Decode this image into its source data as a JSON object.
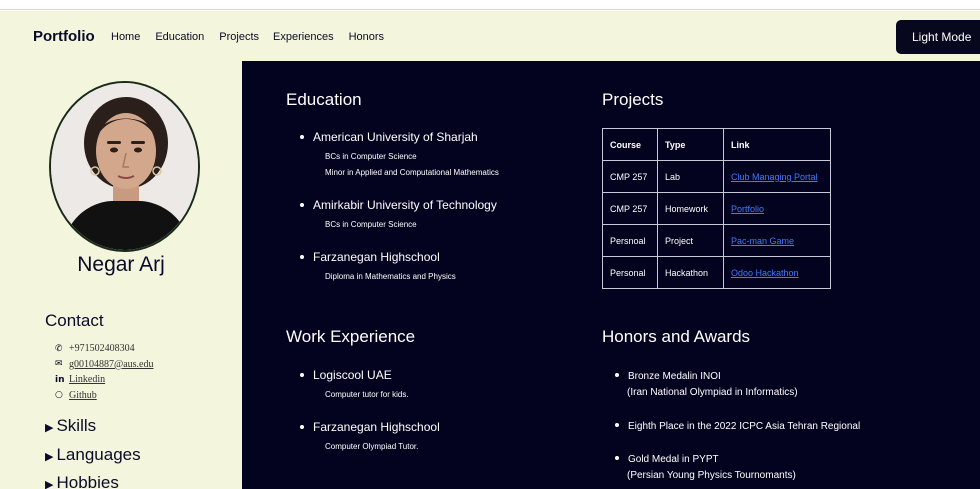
{
  "nav": {
    "brand": "Portfolio",
    "links": [
      "Home",
      "Education",
      "Projects",
      "Experiences",
      "Honors"
    ],
    "mode_button": "Light Mode"
  },
  "sidebar": {
    "name": "Negar Arj",
    "contact_title": "Contact",
    "contacts": [
      {
        "icon": "phone-icon",
        "text": "+971502408304"
      },
      {
        "icon": "email-icon",
        "text": "g00104887@aus.edu"
      },
      {
        "icon": "linkedin-icon",
        "text": "Linkedin"
      },
      {
        "icon": "github-icon",
        "text": "Github"
      }
    ],
    "sections": [
      "Skills",
      "Languages",
      "Hobbies"
    ]
  },
  "education": {
    "title": "Education",
    "items": [
      {
        "name": "American University of Sharjah",
        "details": [
          "BCs in Computer Science",
          "Minor in Applied and Computational Mathematics"
        ]
      },
      {
        "name": "Amirkabir University of Technology",
        "details": [
          "BCs in Computer Science"
        ]
      },
      {
        "name": "Farzanegan Highschool",
        "details": [
          "Diploma in Mathematics and Physics"
        ]
      }
    ]
  },
  "projects": {
    "title": "Projects",
    "headers": [
      "Course",
      "Type",
      "Link"
    ],
    "rows": [
      {
        "course": "CMP 257",
        "type": "Lab",
        "link": "Club Managing Portal"
      },
      {
        "course": "CMP 257",
        "type": "Homework",
        "link": "Portfolio"
      },
      {
        "course": "Persnoal",
        "type": "Project",
        "link": "Pac-man Game"
      },
      {
        "course": "Personal",
        "type": "Hackathon",
        "link": "Odoo Hackathon"
      }
    ]
  },
  "work": {
    "title": "Work Experience",
    "items": [
      {
        "name": "Logiscool UAE",
        "details": [
          "Computer tutor for kids."
        ]
      },
      {
        "name": "Farzanegan Highschool",
        "details": [
          "Computer Olympiad Tutor."
        ]
      }
    ]
  },
  "honors": {
    "title": "Honors and Awards",
    "items": [
      {
        "line1": "Bronze Medalin INOI",
        "line2": "(Iran National Olympiad in Informatics)"
      },
      {
        "line1": "Eighth Place in the 2022 ICPC Asia Tehran Regional",
        "line2": ""
      },
      {
        "line1": "Gold Medal in PYPT",
        "line2": "(Persian Young Physics Tournomants)"
      }
    ]
  }
}
